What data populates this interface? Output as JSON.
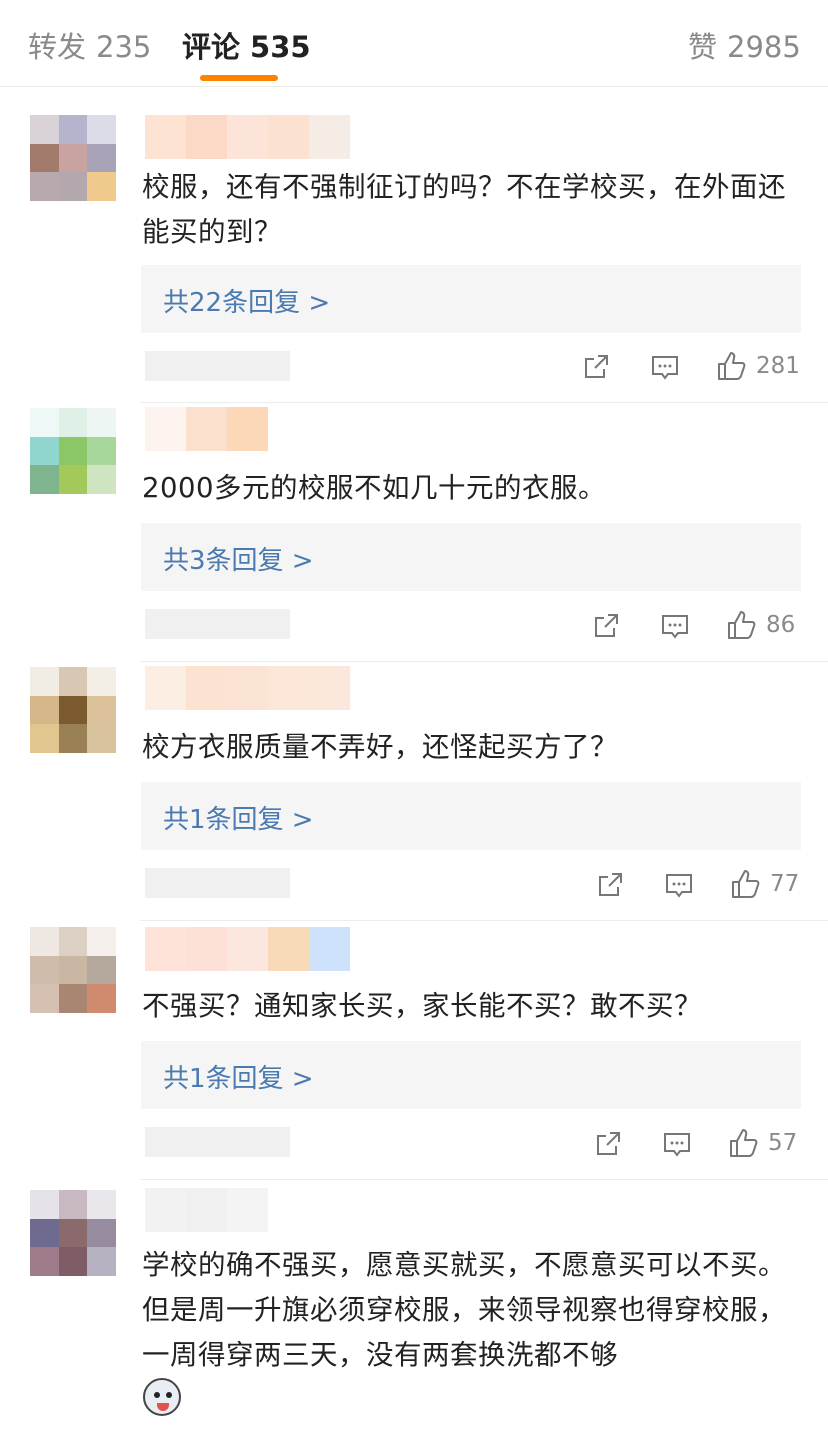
{
  "tabs": [
    {
      "label": "转发",
      "count": "235",
      "active": false
    },
    {
      "label": "评论",
      "count": "535",
      "active": true
    },
    {
      "label": "赞",
      "count": "2985",
      "active": false
    }
  ],
  "accent_color": "#ff8200",
  "link_color": "#4a7ab0",
  "comments": [
    {
      "text": "校服，还有不强制征订的吗？不在学校买，在外面还能买的到？",
      "reply": "共22条回复 >",
      "likes": "281"
    },
    {
      "text": "2000多元的校服不如几十元的衣服。",
      "reply": "共3条回复 >",
      "likes": "86"
    },
    {
      "text": "校方衣服质量不弄好，还怪起买方了？",
      "reply": "共1条回复 >",
      "likes": "77"
    },
    {
      "text": "不强买？通知家长买，家长能不买？敢不买？",
      "reply": "共1条回复 >",
      "likes": "57"
    },
    {
      "text": "学校的确不强买，愿意买就买，不愿意买可以不买。但是周一升旗必须穿校服，来领导视察也得穿校服，一周得穿两三天，没有两套换洗都不够"
    }
  ],
  "icons": {
    "share": "share-icon",
    "comment": "comment-icon",
    "like": "thumbs-up-icon",
    "emoji": "husky-emoji-icon"
  }
}
